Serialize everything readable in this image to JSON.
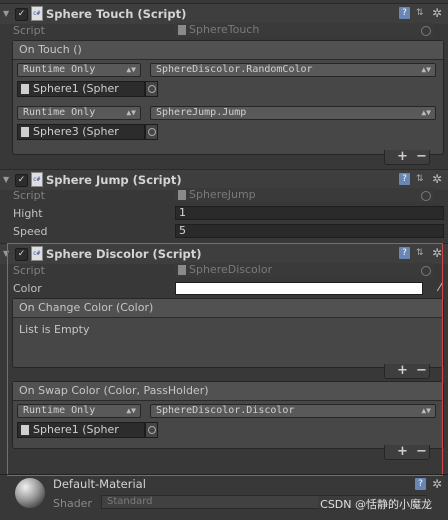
{
  "components": {
    "touch": {
      "title": "Sphere Touch (Script)",
      "script_label": "Script",
      "script_value": "SphereTouch",
      "event": {
        "header": "On Touch ()",
        "entries": [
          {
            "runtime": "Runtime Only",
            "function": "SphereDiscolor.RandomColor",
            "target": "Sphere1 (Spher"
          },
          {
            "runtime": "Runtime Only",
            "function": "SphereJump.Jump",
            "target": "Sphere3 (Spher"
          }
        ]
      }
    },
    "jump": {
      "title": "Sphere Jump (Script)",
      "script_label": "Script",
      "script_value": "SphereJump",
      "hight_label": "Hight",
      "hight_value": "1",
      "speed_label": "Speed",
      "speed_value": "5"
    },
    "discolor": {
      "title": "Sphere Discolor (Script)",
      "script_label": "Script",
      "script_value": "SphereDiscolor",
      "color_label": "Color",
      "color_value": "#ffffff",
      "change_event": {
        "header": "On Change Color (Color)",
        "empty_text": "List is Empty"
      },
      "swap_event": {
        "header": "On Swap Color (Color, PassHolder)",
        "entries": [
          {
            "runtime": "Runtime Only",
            "function": "SphereDiscolor.Discolor",
            "target": "Sphere1 (Spher"
          }
        ]
      }
    }
  },
  "material": {
    "name": "Default-Material",
    "shader_label": "Shader",
    "shader_value": "Standard"
  },
  "icons": {
    "fold": "triangle-down-icon",
    "help": "help-book-icon",
    "preset": "preset-icon",
    "gear": "gear-icon",
    "check": "checkbox-icon"
  },
  "buttons": {
    "plus": "+",
    "minus": "−"
  },
  "watermark": "CSDN @恬静的小魔龙",
  "colors": {
    "highlight": "#d04848",
    "panel": "#383838"
  }
}
